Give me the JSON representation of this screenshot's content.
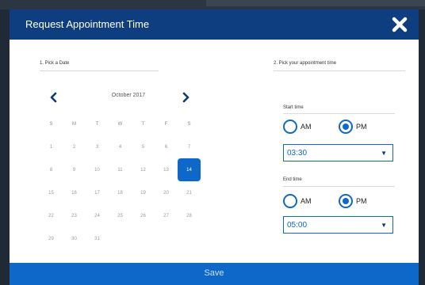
{
  "modal": {
    "title": "Request Appointment Time",
    "close_icon": "close-x-icon",
    "save_label": "Save"
  },
  "sections": {
    "date_label": "1. Pick a Date",
    "time_label": "2. Pick your appointment time"
  },
  "calendar": {
    "month_label": "October 2017",
    "prev_icon": "chevron-left-icon",
    "next_icon": "chevron-right-icon",
    "weekdays": [
      "S",
      "M",
      "T",
      "W",
      "T",
      "F",
      "S"
    ],
    "weeks": [
      [
        "1",
        "2",
        "3",
        "4",
        "5",
        "6",
        "7"
      ],
      [
        "8",
        "9",
        "10",
        "11",
        "12",
        "13",
        "14"
      ],
      [
        "15",
        "16",
        "17",
        "18",
        "19",
        "20",
        "21"
      ],
      [
        "22",
        "23",
        "24",
        "25",
        "26",
        "27",
        "28"
      ],
      [
        "29",
        "30",
        "31"
      ]
    ],
    "selected_day": "14"
  },
  "start_time": {
    "label": "Start time",
    "am_label": "AM",
    "pm_label": "PM",
    "period": "PM",
    "value": "03:30"
  },
  "end_time": {
    "label": "End time",
    "am_label": "AM",
    "pm_label": "PM",
    "period": "PM",
    "value": "05:00"
  },
  "colors": {
    "header": "#0f3e80",
    "accent": "#0d68c9",
    "footer": "#0d68c9"
  }
}
